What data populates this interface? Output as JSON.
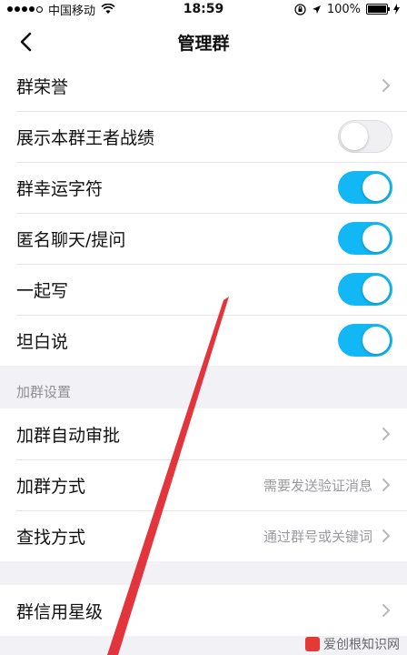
{
  "status_bar": {
    "carrier": "中国移动",
    "time": "18:59",
    "battery_percent": "100%",
    "battery_level": 1.0
  },
  "nav": {
    "title": "管理群",
    "back_icon": "chevron-left-icon"
  },
  "settings_top": [
    {
      "label": "群荣誉",
      "type": "chevron"
    },
    {
      "label": "展示本群王者战绩",
      "type": "toggle",
      "on": false
    },
    {
      "label": "群幸运字符",
      "type": "toggle",
      "on": true
    },
    {
      "label": "匿名聊天/提问",
      "type": "toggle",
      "on": true
    },
    {
      "label": "一起写",
      "type": "toggle",
      "on": true
    },
    {
      "label": "坦白说",
      "type": "toggle",
      "on": true
    }
  ],
  "join_section": {
    "header": "加群设置",
    "items": [
      {
        "label": "加群自动审批",
        "value": ""
      },
      {
        "label": "加群方式",
        "value": "需要发送验证消息"
      },
      {
        "label": "查找方式",
        "value": "通过群号或关键词"
      }
    ]
  },
  "credit_section": {
    "items": [
      {
        "label": "群信用星级",
        "value": ""
      }
    ]
  },
  "watermark": {
    "text": "爱创根知识网"
  },
  "colors": {
    "toggle_on": "#12b7f5",
    "background": "#f2f2f6",
    "annotation_arrow": "#e0242b"
  }
}
